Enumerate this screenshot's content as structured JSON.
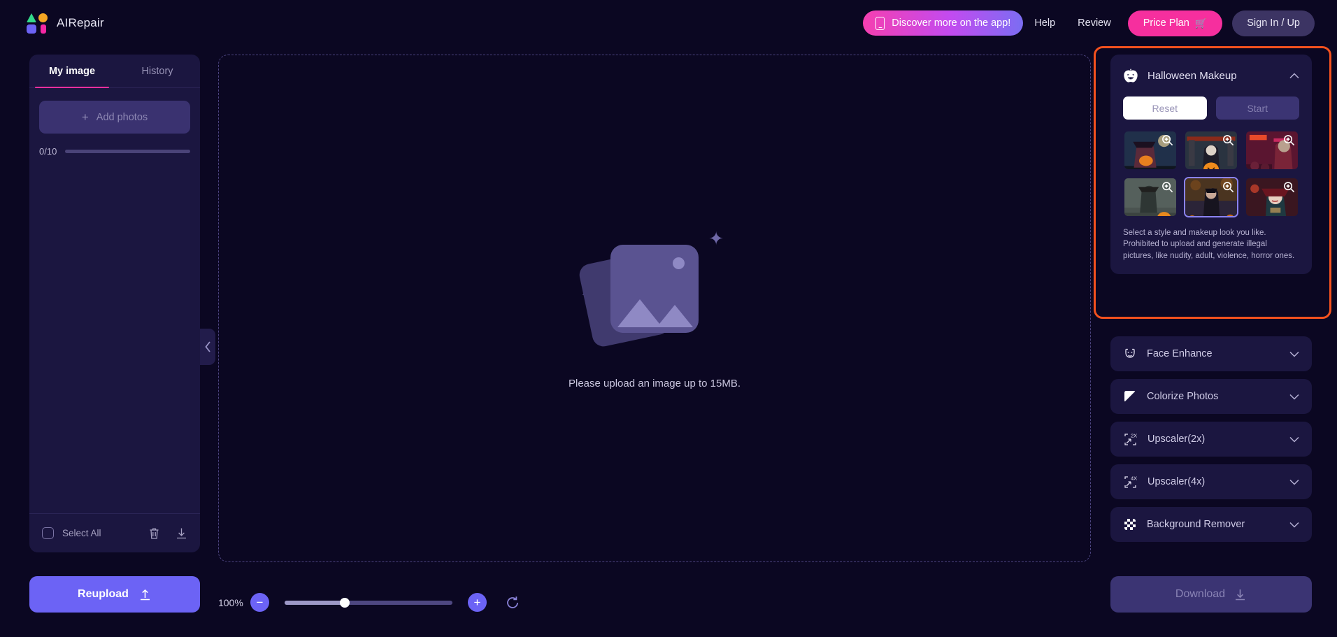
{
  "brand": {
    "name": "AIRepair",
    "logo_icon": "airepair-logo-icon"
  },
  "header": {
    "promo_label": "Discover more on the app!",
    "promo_icon": "phone-icon",
    "help_label": "Help",
    "review_label": "Review",
    "price_label": "Price Plan",
    "price_icon": "shopping-cart-icon",
    "signin_label": "Sign In / Up",
    "accent_pink": "#f62f9e",
    "accent_purple": "#6c63f5"
  },
  "sidebar": {
    "tabs": [
      {
        "label": "My image",
        "active": true
      },
      {
        "label": "History",
        "active": false
      }
    ],
    "add_photos_label": "Add photos",
    "add_photos_icon": "plus-icon",
    "counter": "0/10",
    "counter_value": 0,
    "counter_max": 10,
    "select_all_label": "Select All",
    "delete_icon": "trash-icon",
    "download_icon": "download-icon",
    "collapse_icon": "chevron-left-icon",
    "reupload_label": "Reupload",
    "reupload_icon": "upload-icon"
  },
  "canvas": {
    "message": "Please upload an image up to 15MB.",
    "placeholder_icon": "image-placeholder-icon"
  },
  "zoom": {
    "percent_label": "100%",
    "percent_value": 100,
    "minus_icon": "minus-icon",
    "plus_icon": "plus-icon",
    "reset_icon": "refresh-icon",
    "slider_position_pct": 36
  },
  "right_panel": {
    "highlight_color": "#f4511e",
    "expanded": {
      "title": "Halloween Makeup",
      "icon": "pumpkin-icon",
      "collapse_icon": "chevron-up-icon",
      "reset_label": "Reset",
      "start_label": "Start",
      "description": "Select a style and makeup look you like. Prohibited to upload and generate illegal pictures, like nudity, adult, violence, horror ones.",
      "styles": [
        {
          "name": "witch-with-pumpkin",
          "selected": false,
          "zoom_icon": "magnifier-plus-icon"
        },
        {
          "name": "haunted-gate-clown",
          "selected": false,
          "zoom_icon": "magnifier-plus-icon"
        },
        {
          "name": "neon-street-zombie",
          "selected": false,
          "zoom_icon": "magnifier-plus-icon"
        },
        {
          "name": "graveyard-witch",
          "selected": false,
          "zoom_icon": "magnifier-plus-icon"
        },
        {
          "name": "autumn-forest-witch",
          "selected": true,
          "zoom_icon": "magnifier-plus-icon"
        },
        {
          "name": "red-hat-vampire",
          "selected": false,
          "zoom_icon": "magnifier-plus-icon"
        }
      ]
    },
    "features": [
      {
        "label": "Face Enhance",
        "icon": "face-enhance-icon",
        "chevron": "chevron-down-icon"
      },
      {
        "label": "Colorize Photos",
        "icon": "colorize-icon",
        "chevron": "chevron-down-icon"
      },
      {
        "label": "Upscaler(2x)",
        "icon": "upscaler-2x-icon",
        "chevron": "chevron-down-icon"
      },
      {
        "label": "Upscaler(4x)",
        "icon": "upscaler-4x-icon",
        "chevron": "chevron-down-icon"
      },
      {
        "label": "Background Remover",
        "icon": "checkerboard-icon",
        "chevron": "chevron-down-icon"
      }
    ],
    "download_label": "Download",
    "download_icon": "download-icon",
    "download_disabled": true
  }
}
